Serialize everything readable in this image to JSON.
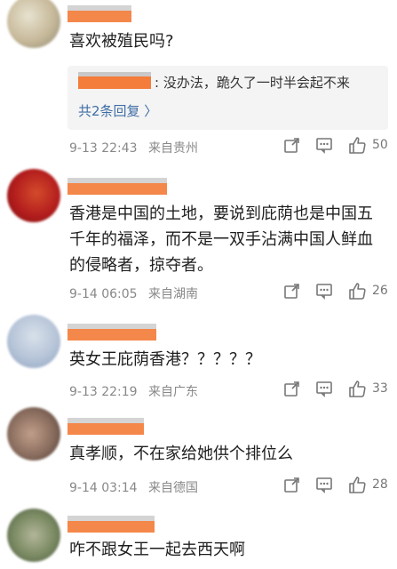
{
  "comments": [
    {
      "avatar_colors": [
        "#e7e2cf",
        "#c7b99a",
        "#8f8a73"
      ],
      "text": "喜欢被殖民吗?",
      "reply_text": ": 没办法，跪久了一时半会起不来",
      "reply_more": "共2条回复 〉",
      "time": "9-13 22:43",
      "location": "来自贵州",
      "likes": "50"
    },
    {
      "avatar_colors": [
        "#b31d1d",
        "#d44b2b",
        "#7b0f0f"
      ],
      "text": "香港是中国的土地，要说到庇荫也是中国五千年的福泽，而不是一双手沾满中国人鲜血的侵略者，掠夺者。",
      "time": "9-14 06:05",
      "location": "来自湖南",
      "likes": "26"
    },
    {
      "avatar_colors": [
        "#b6c4d8",
        "#d8e1ea",
        "#8ea3bf"
      ],
      "text": "英女王庇荫香港？？？？？",
      "time": "9-13 22:19",
      "location": "来自广东",
      "likes": "33"
    },
    {
      "avatar_colors": [
        "#8a6d5e",
        "#c19e8a",
        "#4c3b34"
      ],
      "text": "真孝顺，不在家给她供个排位么",
      "time": "9-14 03:14",
      "location": "来自德国",
      "likes": "28"
    },
    {
      "avatar_colors": [
        "#7a8a62",
        "#b2b59a",
        "#4f5a44"
      ],
      "text": "咋不跟女王一起去西天啊"
    }
  ]
}
